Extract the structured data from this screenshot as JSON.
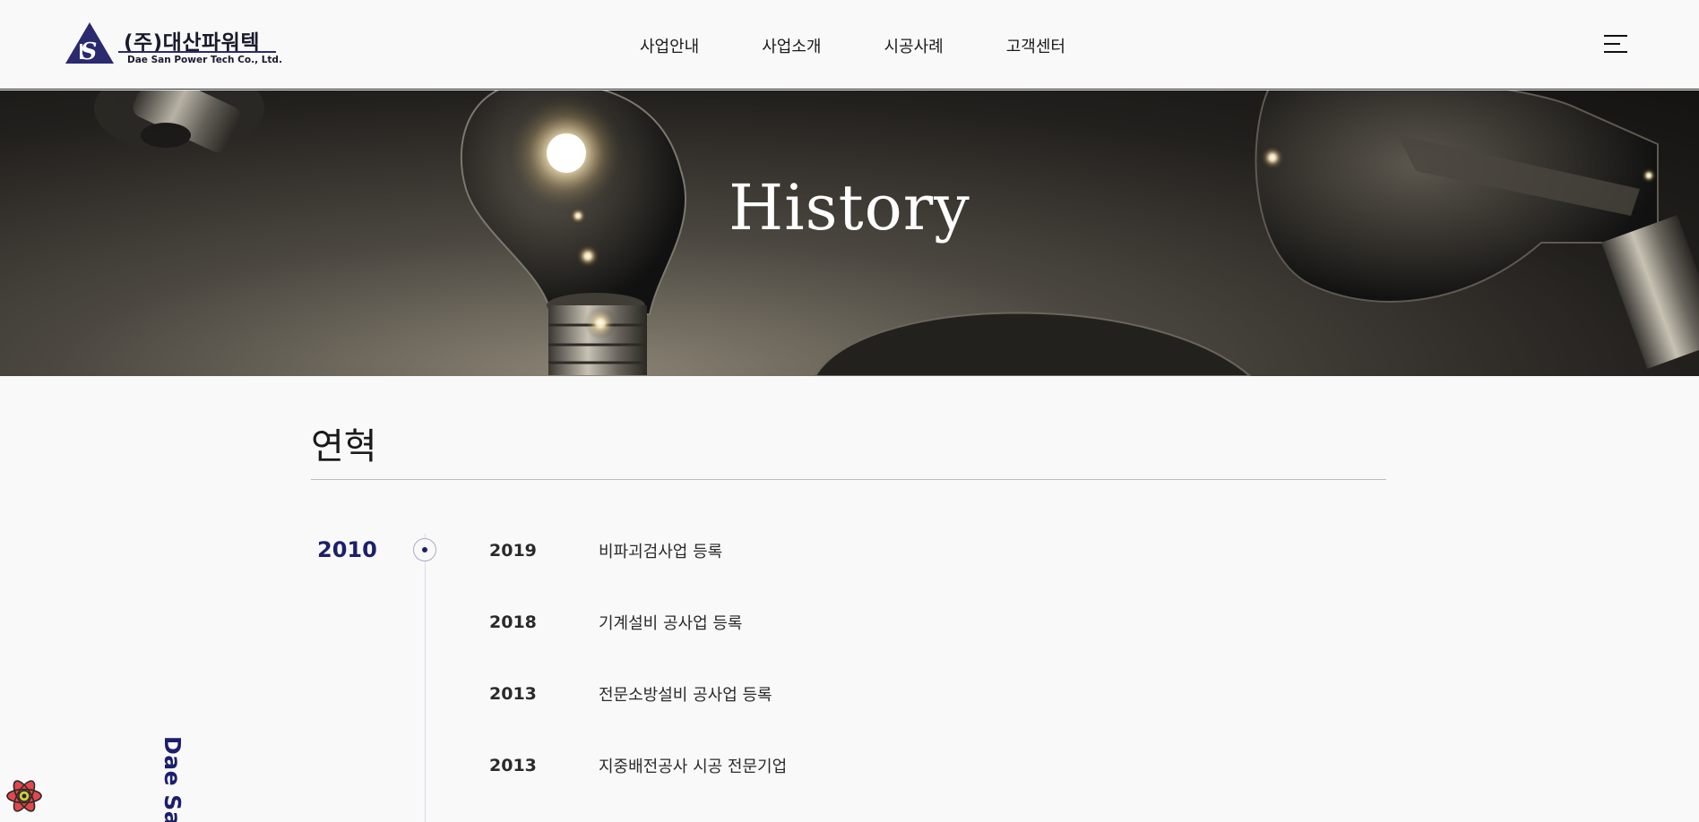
{
  "header": {
    "logo": {
      "korean": "(주)대산파워텍",
      "english": "Dae San Power Tech Co., Ltd.",
      "mark": "S"
    },
    "nav": [
      {
        "label": "사업안내"
      },
      {
        "label": "사업소개"
      },
      {
        "label": "시공사례"
      },
      {
        "label": "고객센터"
      }
    ],
    "menu_icon": "hamburger-menu-icon"
  },
  "hero": {
    "title": "History"
  },
  "main": {
    "heading": "연혁",
    "timeline": {
      "decade": "2010",
      "entries": [
        {
          "year": "2019",
          "text": "비파괴검사업 등록"
        },
        {
          "year": "2018",
          "text": "기계설비 공사업 등록"
        },
        {
          "year": "2013",
          "text": "전문소방설비 공사업 등록"
        },
        {
          "year": "2013",
          "text": "지중배전공사 시공 전문기업"
        }
      ]
    },
    "side_label": "Dae San"
  },
  "colors": {
    "accent": "#1b1f6b",
    "logo": "#2b2a6e",
    "text": "#222222",
    "background": "#f9f9f9"
  }
}
